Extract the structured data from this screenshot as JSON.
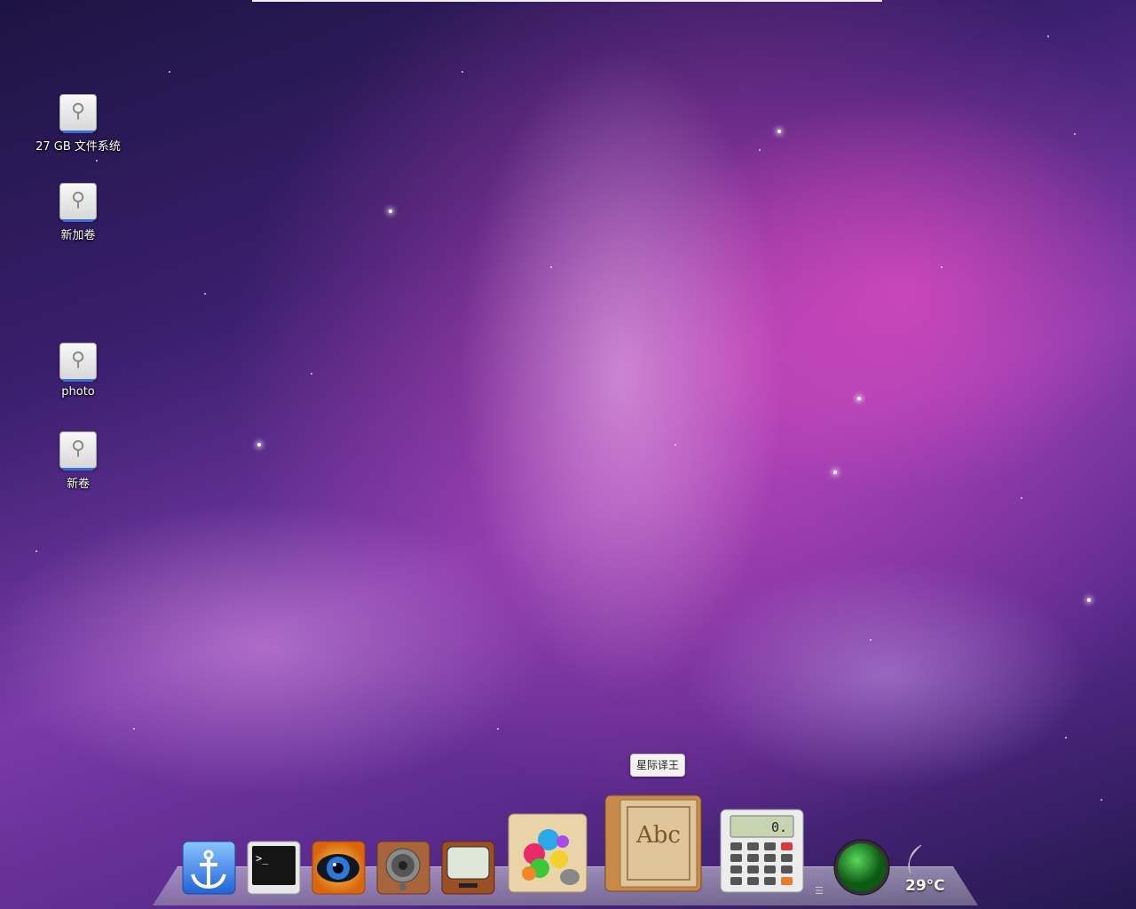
{
  "desktop": {
    "icons": [
      {
        "label": "27 GB 文件系统",
        "icon": "usb-drive-icon"
      },
      {
        "label": "新加卷",
        "icon": "usb-drive-icon"
      },
      {
        "label": "photo",
        "icon": "usb-drive-icon"
      },
      {
        "label": "新卷",
        "icon": "usb-drive-icon"
      }
    ]
  },
  "dock": {
    "tooltip": "星际译王",
    "items": [
      {
        "icon": "anchor-icon"
      },
      {
        "icon": "terminal-icon"
      },
      {
        "icon": "eye-icon"
      },
      {
        "icon": "speaker-icon"
      },
      {
        "icon": "tv-icon"
      },
      {
        "icon": "paint-palette-icon"
      },
      {
        "icon": "dictionary-book-icon",
        "book_text": "Abc"
      },
      {
        "icon": "calculator-icon",
        "display": "0."
      },
      {
        "icon": "green-orb-icon"
      }
    ],
    "weather": {
      "temperature": "29°C",
      "icon": "moon-icon"
    }
  }
}
